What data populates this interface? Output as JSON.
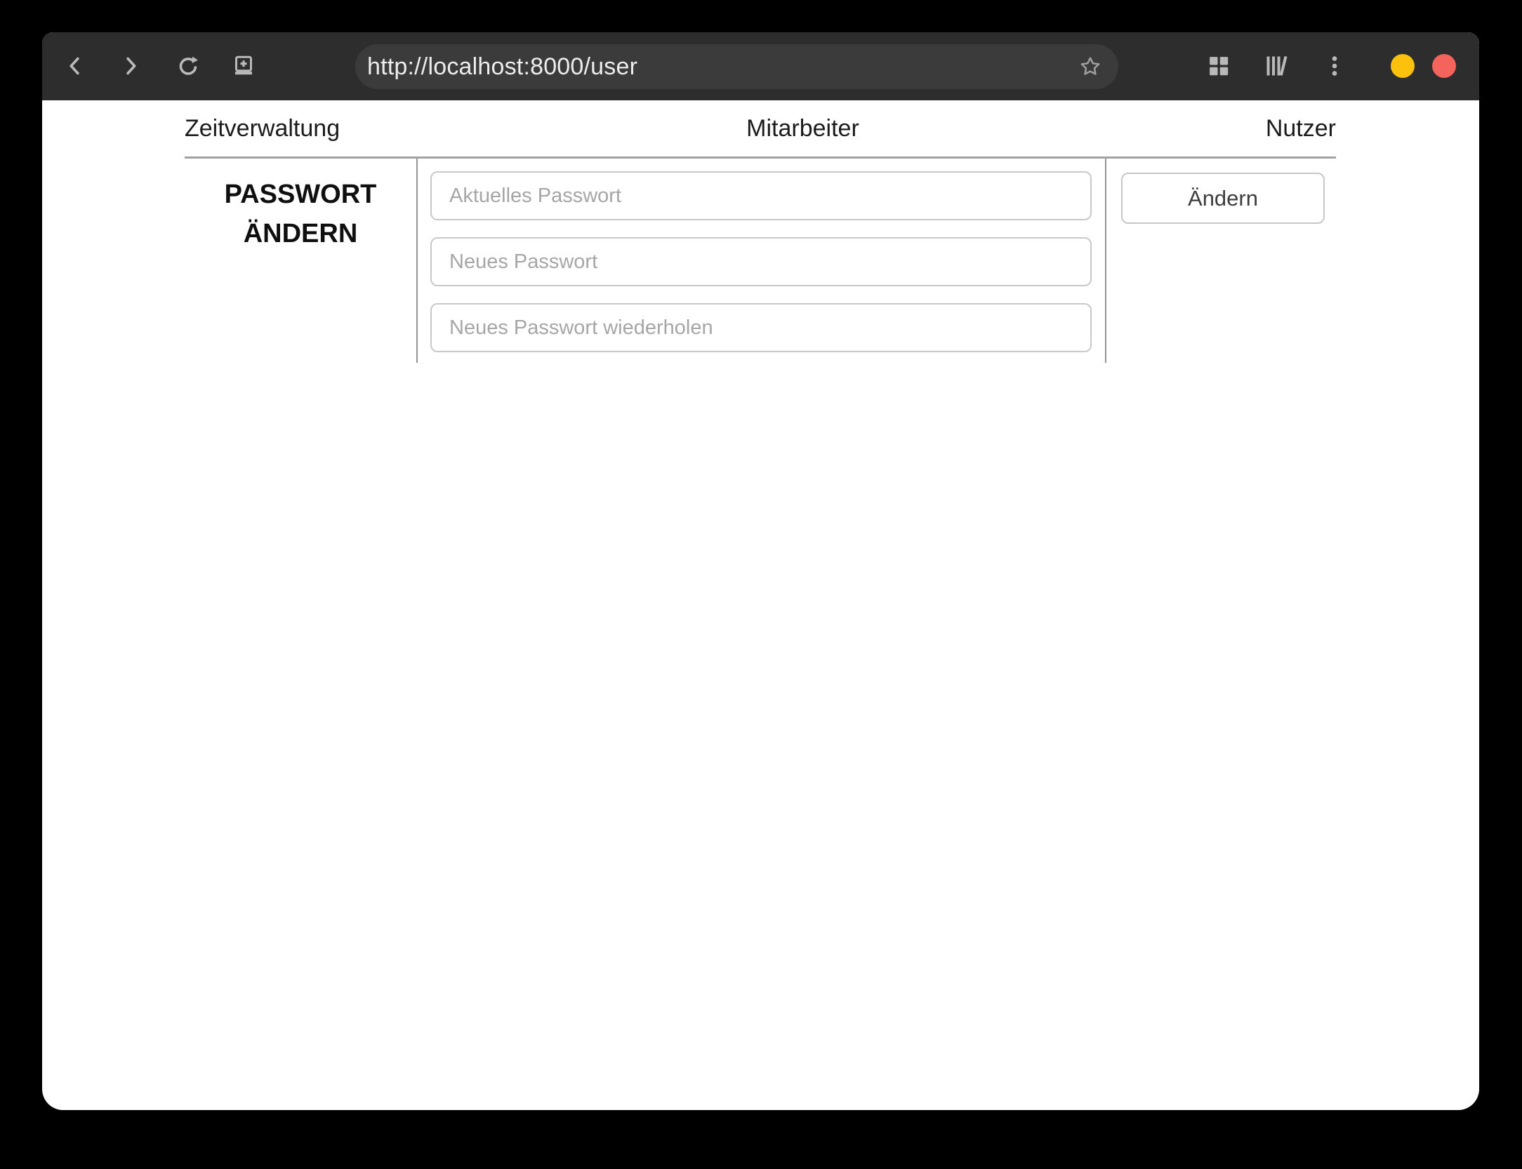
{
  "browser": {
    "url": "http://localhost:8000/user",
    "toolbar_icons": {
      "back": "chevron-left-icon",
      "forward": "chevron-right-icon",
      "reload": "reload-icon",
      "new_tab": "screen-plus-icon",
      "bookmark": "star-outline-icon",
      "apps": "grid-icon",
      "library": "library-icon",
      "menu": "kebab-menu-icon"
    },
    "window_controls": {
      "minimize_color": "#fbc10d",
      "close_color": "#f4635c"
    }
  },
  "nav": {
    "items": [
      {
        "label": "Zeitverwaltung"
      },
      {
        "label": "Mitarbeiter"
      },
      {
        "label": "Nutzer"
      }
    ]
  },
  "password_section": {
    "heading": "PASSWORT ÄNDERN",
    "fields": [
      {
        "placeholder": "Aktuelles Passwort",
        "value": ""
      },
      {
        "placeholder": "Neues Passwort",
        "value": ""
      },
      {
        "placeholder": "Neues Passwort wiederholen",
        "value": ""
      }
    ],
    "submit_label": "Ändern"
  },
  "colors": {
    "chrome_bg": "#2d2d2d",
    "urlbar_bg": "#3b3b3b",
    "page_bg": "#ffffff",
    "table_border": "#a2a2a2",
    "input_border": "#c9c9c9",
    "placeholder": "#a6a6a6"
  }
}
